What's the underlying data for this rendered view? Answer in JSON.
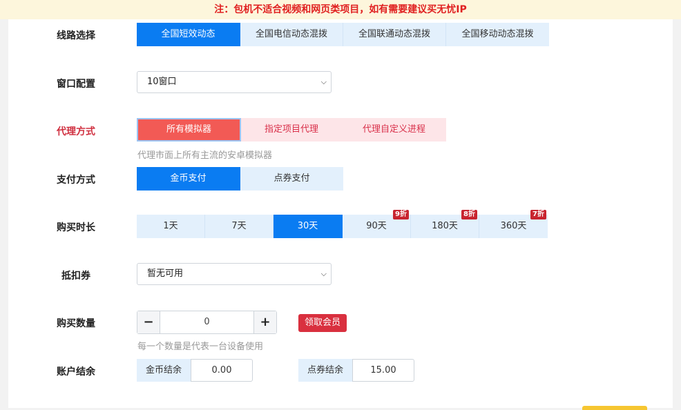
{
  "notice": "注：包机不适合视频和网页类项目，如有需要建议买无忧IP",
  "line": {
    "label": "线路选择",
    "options": [
      "全国短效动态",
      "全国电信动态混拨",
      "全国联通动态混拨",
      "全国移动动态混拨"
    ],
    "active_index": 0
  },
  "window": {
    "label": "窗口配置",
    "selected": "10窗口"
  },
  "proxy": {
    "label": "代理方式",
    "options": [
      "所有模拟器",
      "指定项目代理",
      "代理自定义进程"
    ],
    "active_index": 0,
    "hint": "代理市面上所有主流的安卓模拟器"
  },
  "payment": {
    "label": "支付方式",
    "options": [
      "金币支付",
      "点券支付"
    ],
    "active_index": 0
  },
  "duration": {
    "label": "购买时长",
    "options": [
      {
        "label": "1天",
        "badge": ""
      },
      {
        "label": "7天",
        "badge": ""
      },
      {
        "label": "30天",
        "badge": ""
      },
      {
        "label": "90天",
        "badge": "9折"
      },
      {
        "label": "180天",
        "badge": "8折"
      },
      {
        "label": "360天",
        "badge": "7折"
      }
    ],
    "active_index": 2
  },
  "coupon": {
    "label": "抵扣券",
    "selected": "暂无可用"
  },
  "quantity": {
    "label": "购买数量",
    "minus": "−",
    "plus": "+",
    "value": "0",
    "vip_button": "领取会员",
    "hint": "每一个数量是代表一台设备使用"
  },
  "balance": {
    "label": "账户结余",
    "gold_caption": "金币结余",
    "gold_value": "0.00",
    "point_caption": "点券结余",
    "point_value": "15.00"
  },
  "colors": {
    "primary": "#0a7cf2",
    "danger": "#d9303f",
    "notice_bg": "#fdf6dc"
  }
}
